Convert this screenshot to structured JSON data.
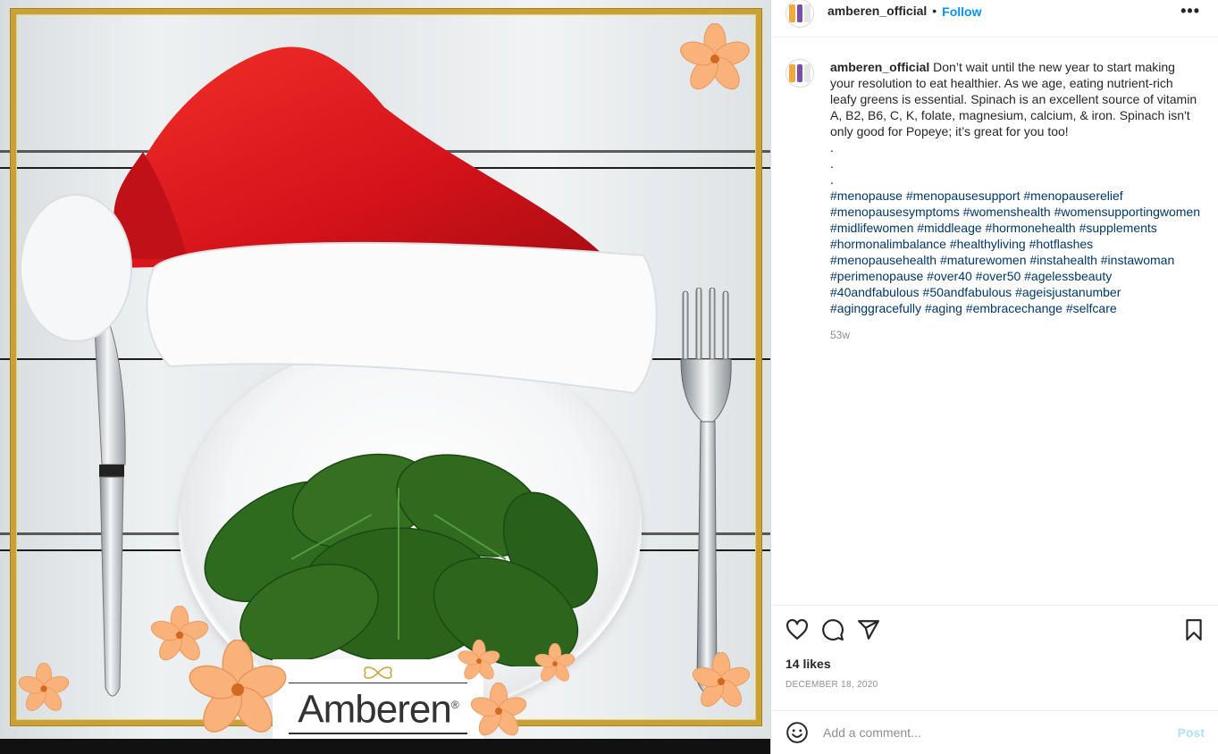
{
  "header": {
    "username": "amberen_official",
    "separator": "•",
    "follow_label": "Follow",
    "more_label": "•••"
  },
  "image": {
    "logo_text": "Amberen",
    "logo_mark": "®",
    "colors": {
      "frame_gold": "#c9a236",
      "hat_red": "#e01b1b",
      "flower_peach": "#f8b27a",
      "spinach_green": "#2e6b1f"
    }
  },
  "caption": {
    "username": "amberen_official",
    "text": "Don’t wait until the new year to start making your resolution to eat healthier. As we age, eating nutrient-rich leafy greens is essential. Spinach is an excellent source of vitamin A, B2, B6, C, K, folate, magnesium, calcium, & iron. Spinach isn't only good for Popeye; it’s great for you too!",
    "dots": [
      ".",
      ".",
      "."
    ],
    "hashtags": "#menopause #menopausesupport #menopauserelief #menopausesymptoms #womenshealth #womensupportingwomen #midlifewomen #middleage #hormonehealth #supplements #hormonalimbalance #healthyliving #hotflashes #menopausehealth #maturewomen #instahealth #instawoman #perimenopause #over40 #over50 #agelessbeauty #40andfabulous #50andfabulous #ageisjustanumber #aginggracefully #aging #embracechange #selfcare",
    "time_ago": "53w"
  },
  "actions": {
    "icons": [
      "heart-icon",
      "comment-icon",
      "share-icon",
      "bookmark-icon"
    ],
    "likes": "14 likes",
    "date": "DECEMBER 18, 2020"
  },
  "comment": {
    "placeholder": "Add a comment...",
    "post_label": "Post",
    "emoji_icon": "smile-icon"
  }
}
